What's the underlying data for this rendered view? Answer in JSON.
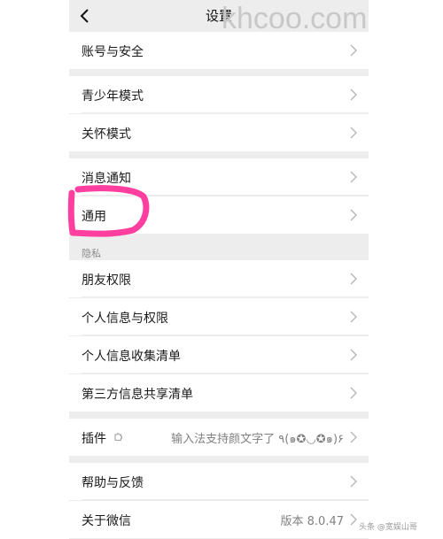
{
  "header": {
    "title": "设置",
    "back_icon": "chevron-left-icon"
  },
  "rows": {
    "account_security": "账号与安全",
    "youth_mode": "青少年模式",
    "care_mode": "关怀模式",
    "notifications": "消息通知",
    "general": "通用",
    "friend_permissions": "朋友权限",
    "personal_info_permissions": "个人信息与权限",
    "personal_info_collection": "个人信息收集清单",
    "third_party_sharing": "第三方信息共享清单",
    "plugins": "插件",
    "plugins_value": "输入法支持颜文字了 ٩(๑✪◡✪๑)۶",
    "help_feedback": "帮助与反馈",
    "about_wechat": "关于微信",
    "version": "版本 8.0.47"
  },
  "sections": {
    "privacy": "隐私"
  },
  "watermark": "khcoo.com",
  "credit": "头条 @宽娱山哥",
  "highlight": {
    "color": "#ff3fa0",
    "target": "general"
  },
  "colors": {
    "background": "#ededed",
    "card": "#ffffff",
    "text": "#1a1a1a",
    "secondary": "#808080"
  },
  "icons": {
    "chevron": "chevron-right-icon",
    "plugin": "puzzle-icon"
  }
}
